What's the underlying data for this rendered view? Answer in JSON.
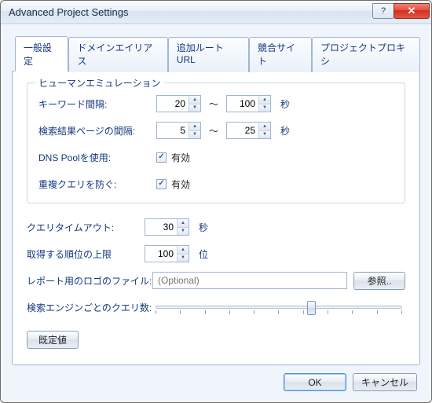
{
  "window": {
    "title": "Advanced Project Settings"
  },
  "tabs": [
    {
      "label": "一般設定"
    },
    {
      "label": "ドメインエイリアス"
    },
    {
      "label": "追加ルートURL"
    },
    {
      "label": "競合サイト"
    },
    {
      "label": "プロジェクトプロキシ"
    }
  ],
  "group": {
    "legend": "ヒューマンエミュレーション",
    "keyword_interval_label": "キーワード間隔:",
    "keyword_min": "20",
    "keyword_max": "100",
    "serp_interval_label": "検索結果ページの間隔:",
    "serp_min": "5",
    "serp_max": "25",
    "range_sep": "～",
    "unit_sec": "秒",
    "dns_label": "DNS Poolを使用:",
    "dup_label": "重複クエリを防ぐ:",
    "enabled": "有効"
  },
  "fields": {
    "timeout_label": "クエリタイムアウト:",
    "timeout_value": "30",
    "timeout_unit": "秒",
    "rank_label": "取得する順位の上限",
    "rank_value": "100",
    "rank_unit": "位",
    "logo_label": "レポート用のロゴのファイル:",
    "logo_placeholder": "(Optional)",
    "browse": "参照..",
    "qps_label": "検索エンジンごとのクエリ数:"
  },
  "slider": {
    "pct": 63
  },
  "buttons": {
    "defaults": "既定値",
    "ok": "OK",
    "cancel": "キャンセル"
  }
}
